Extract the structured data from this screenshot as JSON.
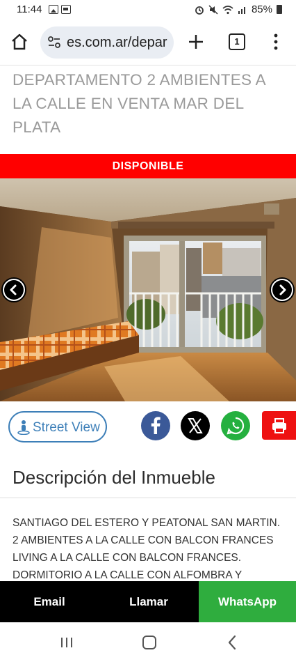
{
  "status_bar": {
    "time": "11:44",
    "battery": "85%"
  },
  "browser": {
    "url": "es.com.ar/depar",
    "tab_count": "1"
  },
  "listing": {
    "title": "DEPARTAMENTO 2 AMBIENTES A LA CALLE EN VENTA MAR DEL PLATA",
    "availability": "DISPONIBLE"
  },
  "actions": {
    "street_view_label": "Street View"
  },
  "description": {
    "heading": "Descripción del Inmueble",
    "lines": [
      "SANTIAGO DEL ESTERO Y PEATONAL SAN MARTIN.",
      "2 AMBIENTES A LA CALLE CON BALCON FRANCES",
      "LIVING A LA CALLE CON BALCON FRANCES.",
      "DORMITORIO A LA CALLE CON ALFOMBRA Y"
    ]
  },
  "contact_bar": {
    "email": "Email",
    "call": "Llamar",
    "whatsapp": "WhatsApp"
  },
  "colors": {
    "banner": "#ff0000",
    "street_view": "#3d7fb8",
    "facebook": "#3b5998",
    "whatsapp": "#25b03f",
    "print": "#ee1111",
    "whatsapp_bar": "#2fad3e"
  }
}
